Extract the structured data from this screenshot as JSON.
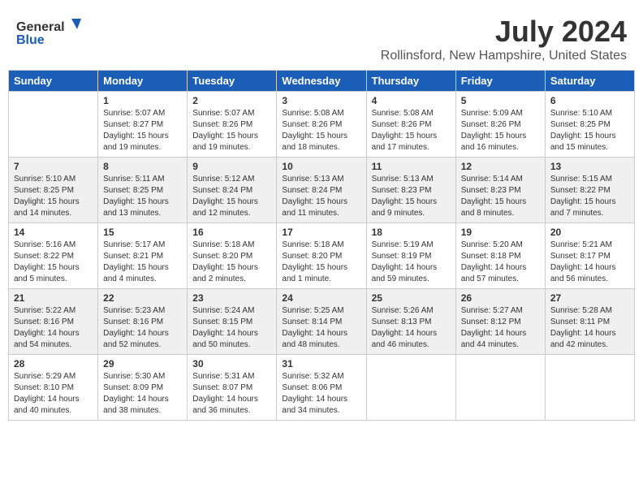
{
  "logo": {
    "general": "General",
    "blue": "Blue"
  },
  "title": "July 2024",
  "subtitle": "Rollinsford, New Hampshire, United States",
  "headers": [
    "Sunday",
    "Monday",
    "Tuesday",
    "Wednesday",
    "Thursday",
    "Friday",
    "Saturday"
  ],
  "weeks": [
    [
      {
        "day": "",
        "sunrise": "",
        "sunset": "",
        "daylight": ""
      },
      {
        "day": "1",
        "sunrise": "Sunrise: 5:07 AM",
        "sunset": "Sunset: 8:27 PM",
        "daylight": "Daylight: 15 hours and 19 minutes."
      },
      {
        "day": "2",
        "sunrise": "Sunrise: 5:07 AM",
        "sunset": "Sunset: 8:26 PM",
        "daylight": "Daylight: 15 hours and 19 minutes."
      },
      {
        "day": "3",
        "sunrise": "Sunrise: 5:08 AM",
        "sunset": "Sunset: 8:26 PM",
        "daylight": "Daylight: 15 hours and 18 minutes."
      },
      {
        "day": "4",
        "sunrise": "Sunrise: 5:08 AM",
        "sunset": "Sunset: 8:26 PM",
        "daylight": "Daylight: 15 hours and 17 minutes."
      },
      {
        "day": "5",
        "sunrise": "Sunrise: 5:09 AM",
        "sunset": "Sunset: 8:26 PM",
        "daylight": "Daylight: 15 hours and 16 minutes."
      },
      {
        "day": "6",
        "sunrise": "Sunrise: 5:10 AM",
        "sunset": "Sunset: 8:25 PM",
        "daylight": "Daylight: 15 hours and 15 minutes."
      }
    ],
    [
      {
        "day": "7",
        "sunrise": "Sunrise: 5:10 AM",
        "sunset": "Sunset: 8:25 PM",
        "daylight": "Daylight: 15 hours and 14 minutes."
      },
      {
        "day": "8",
        "sunrise": "Sunrise: 5:11 AM",
        "sunset": "Sunset: 8:25 PM",
        "daylight": "Daylight: 15 hours and 13 minutes."
      },
      {
        "day": "9",
        "sunrise": "Sunrise: 5:12 AM",
        "sunset": "Sunset: 8:24 PM",
        "daylight": "Daylight: 15 hours and 12 minutes."
      },
      {
        "day": "10",
        "sunrise": "Sunrise: 5:13 AM",
        "sunset": "Sunset: 8:24 PM",
        "daylight": "Daylight: 15 hours and 11 minutes."
      },
      {
        "day": "11",
        "sunrise": "Sunrise: 5:13 AM",
        "sunset": "Sunset: 8:23 PM",
        "daylight": "Daylight: 15 hours and 9 minutes."
      },
      {
        "day": "12",
        "sunrise": "Sunrise: 5:14 AM",
        "sunset": "Sunset: 8:23 PM",
        "daylight": "Daylight: 15 hours and 8 minutes."
      },
      {
        "day": "13",
        "sunrise": "Sunrise: 5:15 AM",
        "sunset": "Sunset: 8:22 PM",
        "daylight": "Daylight: 15 hours and 7 minutes."
      }
    ],
    [
      {
        "day": "14",
        "sunrise": "Sunrise: 5:16 AM",
        "sunset": "Sunset: 8:22 PM",
        "daylight": "Daylight: 15 hours and 5 minutes."
      },
      {
        "day": "15",
        "sunrise": "Sunrise: 5:17 AM",
        "sunset": "Sunset: 8:21 PM",
        "daylight": "Daylight: 15 hours and 4 minutes."
      },
      {
        "day": "16",
        "sunrise": "Sunrise: 5:18 AM",
        "sunset": "Sunset: 8:20 PM",
        "daylight": "Daylight: 15 hours and 2 minutes."
      },
      {
        "day": "17",
        "sunrise": "Sunrise: 5:18 AM",
        "sunset": "Sunset: 8:20 PM",
        "daylight": "Daylight: 15 hours and 1 minute."
      },
      {
        "day": "18",
        "sunrise": "Sunrise: 5:19 AM",
        "sunset": "Sunset: 8:19 PM",
        "daylight": "Daylight: 14 hours and 59 minutes."
      },
      {
        "day": "19",
        "sunrise": "Sunrise: 5:20 AM",
        "sunset": "Sunset: 8:18 PM",
        "daylight": "Daylight: 14 hours and 57 minutes."
      },
      {
        "day": "20",
        "sunrise": "Sunrise: 5:21 AM",
        "sunset": "Sunset: 8:17 PM",
        "daylight": "Daylight: 14 hours and 56 minutes."
      }
    ],
    [
      {
        "day": "21",
        "sunrise": "Sunrise: 5:22 AM",
        "sunset": "Sunset: 8:16 PM",
        "daylight": "Daylight: 14 hours and 54 minutes."
      },
      {
        "day": "22",
        "sunrise": "Sunrise: 5:23 AM",
        "sunset": "Sunset: 8:16 PM",
        "daylight": "Daylight: 14 hours and 52 minutes."
      },
      {
        "day": "23",
        "sunrise": "Sunrise: 5:24 AM",
        "sunset": "Sunset: 8:15 PM",
        "daylight": "Daylight: 14 hours and 50 minutes."
      },
      {
        "day": "24",
        "sunrise": "Sunrise: 5:25 AM",
        "sunset": "Sunset: 8:14 PM",
        "daylight": "Daylight: 14 hours and 48 minutes."
      },
      {
        "day": "25",
        "sunrise": "Sunrise: 5:26 AM",
        "sunset": "Sunset: 8:13 PM",
        "daylight": "Daylight: 14 hours and 46 minutes."
      },
      {
        "day": "26",
        "sunrise": "Sunrise: 5:27 AM",
        "sunset": "Sunset: 8:12 PM",
        "daylight": "Daylight: 14 hours and 44 minutes."
      },
      {
        "day": "27",
        "sunrise": "Sunrise: 5:28 AM",
        "sunset": "Sunset: 8:11 PM",
        "daylight": "Daylight: 14 hours and 42 minutes."
      }
    ],
    [
      {
        "day": "28",
        "sunrise": "Sunrise: 5:29 AM",
        "sunset": "Sunset: 8:10 PM",
        "daylight": "Daylight: 14 hours and 40 minutes."
      },
      {
        "day": "29",
        "sunrise": "Sunrise: 5:30 AM",
        "sunset": "Sunset: 8:09 PM",
        "daylight": "Daylight: 14 hours and 38 minutes."
      },
      {
        "day": "30",
        "sunrise": "Sunrise: 5:31 AM",
        "sunset": "Sunset: 8:07 PM",
        "daylight": "Daylight: 14 hours and 36 minutes."
      },
      {
        "day": "31",
        "sunrise": "Sunrise: 5:32 AM",
        "sunset": "Sunset: 8:06 PM",
        "daylight": "Daylight: 14 hours and 34 minutes."
      },
      {
        "day": "",
        "sunrise": "",
        "sunset": "",
        "daylight": ""
      },
      {
        "day": "",
        "sunrise": "",
        "sunset": "",
        "daylight": ""
      },
      {
        "day": "",
        "sunrise": "",
        "sunset": "",
        "daylight": ""
      }
    ]
  ]
}
